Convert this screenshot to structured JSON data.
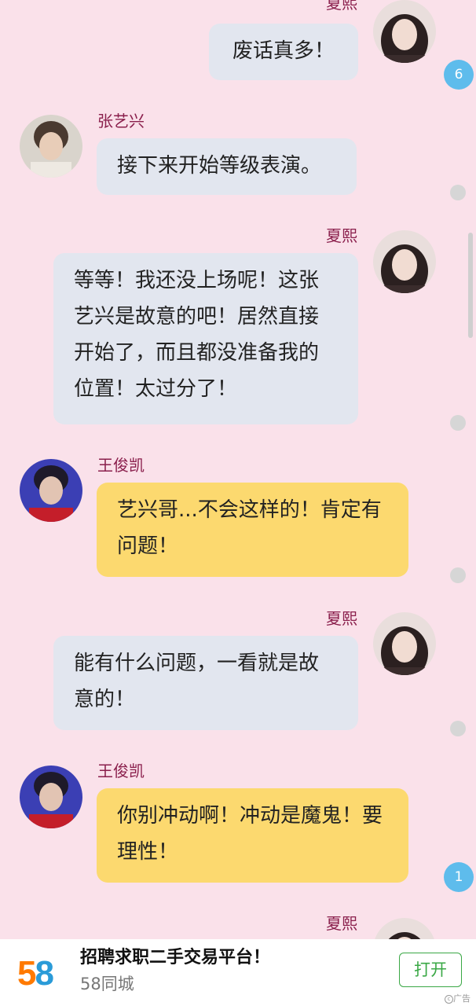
{
  "messages": [
    {
      "speaker": "夏熙",
      "text": "废话真多！"
    },
    {
      "speaker": "张艺兴",
      "text": "接下来开始等级表演。"
    },
    {
      "speaker": "夏熙",
      "text": "等等！我还没上场呢！这张艺兴是故意的吧！居然直接开始了，而且都没准备我的位置！太过分了！"
    },
    {
      "speaker": "王俊凯",
      "text": "艺兴哥...不会这样的！肯定有问题！"
    },
    {
      "speaker": "夏熙",
      "text": "能有什么问题，一看就是故意的！"
    },
    {
      "speaker": "王俊凯",
      "text": "你别冲动啊！冲动是魔鬼！要理性！"
    },
    {
      "speaker": "夏熙",
      "text": ""
    }
  ],
  "badges": {
    "first": "6",
    "second": "1"
  },
  "ad": {
    "logo": "58",
    "title": "招聘求职二手交易平台！",
    "subtitle": "58同城",
    "open_label": "打开",
    "tag": "广告"
  },
  "colors": {
    "background": "#fae1ea",
    "grey_bubble": "#e2e6ef",
    "yellow_bubble": "#fcd96f",
    "name_text": "#8a1f4c",
    "badge": "#5ebcec",
    "open_button": "#3aa845"
  }
}
